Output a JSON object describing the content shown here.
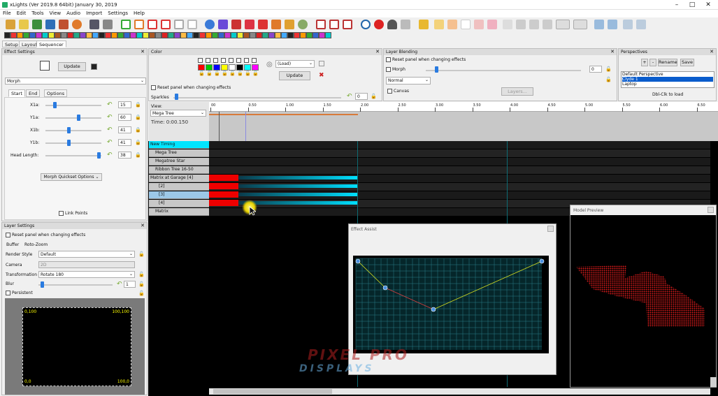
{
  "window": {
    "title": "xLights (Ver 2019.8 64bit) January 30, 2019"
  },
  "menu": [
    "File",
    "Edit",
    "Tools",
    "View",
    "Audio",
    "Import",
    "Settings",
    "Help"
  ],
  "view_tabs": [
    "Setup",
    "Layout",
    "Sequencer"
  ],
  "effect_settings": {
    "header": "Effect Settings",
    "update_label": "Update",
    "effect_name": "Morph",
    "tabs": [
      "Start",
      "End",
      "Options"
    ],
    "sliders": [
      {
        "label": "X1a:",
        "value": "15",
        "fraction": 0.15
      },
      {
        "label": "Y1a:",
        "value": "60",
        "fraction": 0.6
      },
      {
        "label": "X1b:",
        "value": "41",
        "fraction": 0.41
      },
      {
        "label": "Y1b:",
        "value": "41",
        "fraction": 0.41
      },
      {
        "label": "Head Length:",
        "value": "38",
        "fraction": 0.98
      }
    ],
    "link_points_label": "Link Points",
    "quickset_label": "Morph Quickset Options"
  },
  "color": {
    "header": "Color",
    "swatches": [
      "#ff0000",
      "#00cc00",
      "#0000ff",
      "#ffff00",
      "#ffffff",
      "#000000",
      "#00ffff",
      "#ff00ff"
    ],
    "load_label": "(Load)",
    "update_label": "Update",
    "reset_label": "Reset panel when changing effects",
    "sparkles_label": "Sparkles",
    "sparkles_value": "0"
  },
  "layer_blending": {
    "header": "Layer Blending",
    "reset_label": "Reset panel when changing effects",
    "morph_label": "Morph",
    "morph_value": "0",
    "mode_value": "Normal",
    "canvas_label": "Canvas",
    "layers_label": "Layers..."
  },
  "perspectives": {
    "header": "Perspectives",
    "add_label": "+",
    "remove_label": "-",
    "rename_label": "Rename",
    "save_label": "Save",
    "items": [
      "Default Perspective",
      "Clyde 1",
      "Laptop"
    ],
    "selected": "Clyde 1",
    "hint": "Dbl-Clk to load"
  },
  "sequencer": {
    "view_label": "View:",
    "view_value": "Mega Tree",
    "time": "Time: 0:00.150",
    "ticks": [
      "00",
      "0.50",
      "1.00",
      "1.50",
      "2.00",
      "2.50",
      "3.00",
      "3.50",
      "4.00",
      "4.50",
      "5.00",
      "5.50",
      "6.00",
      "6.50"
    ],
    "rows": [
      "New Timing",
      "Mega Tree",
      "Megatree Star",
      "Ribbon Tree 16-50",
      "Matrix at Garage [4]",
      "[2]",
      "[3]",
      "[4]",
      "Matrix"
    ]
  },
  "layer_settings": {
    "header": "Layer Settings",
    "reset_label": "Reset panel when changing effects",
    "buffer_label": "Buffer",
    "rotozoom_label": "Roto-Zoom",
    "render_style_label": "Render Style",
    "render_style_value": "Default",
    "camera_label": "Camera",
    "camera_value": "2D",
    "transformation_label": "Transformation",
    "transformation_value": "Rotate 180",
    "blur_label": "Blur",
    "blur_value": "1",
    "persistent_label": "Persistent",
    "corner_tl": "0,100",
    "corner_tr": "100,100",
    "corner_bl": "0,0",
    "corner_br": "100,0"
  },
  "effect_assist": {
    "title": "Effect Assist"
  },
  "model_preview": {
    "title": "Model Preview"
  },
  "watermark": {
    "top": "PIXEL PRO",
    "bottom": "DISPLAYS"
  }
}
